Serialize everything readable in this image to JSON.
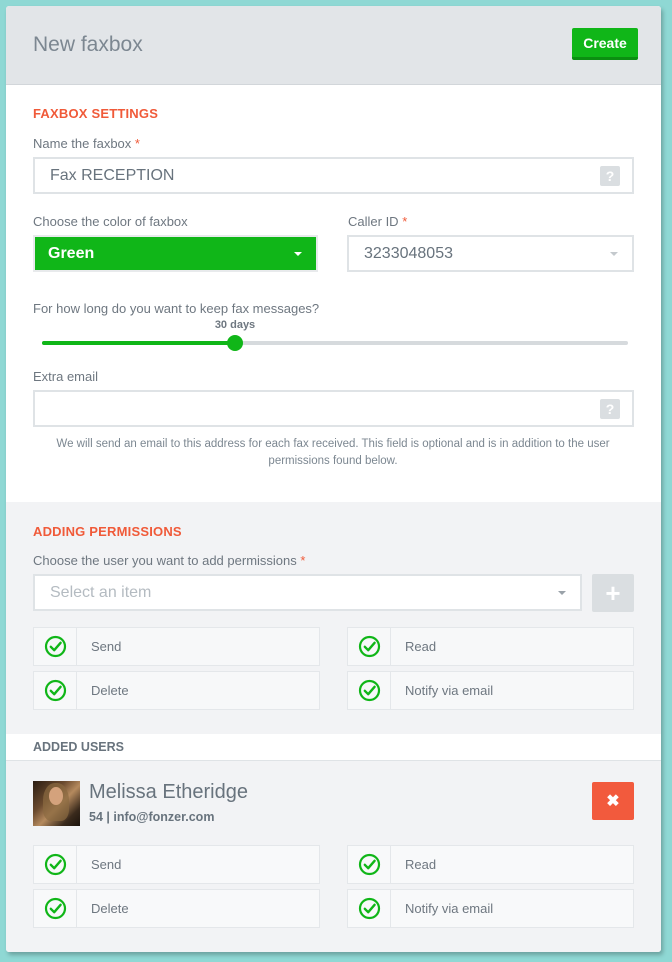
{
  "header": {
    "title": "New faxbox",
    "create_label": "Create"
  },
  "settings": {
    "section_title": "FAXBOX SETTINGS",
    "name_label": "Name the faxbox",
    "name_value": "Fax RECEPTION",
    "color_label": "Choose the color of faxbox",
    "color_value": "Green",
    "caller_id_label": "Caller ID",
    "caller_id_value": "3233048053",
    "retention_label": "For how long do you want to keep fax messages?",
    "retention_value": "30 days",
    "retention_fraction": 0.33,
    "extra_email_label": "Extra email",
    "extra_email_value": "",
    "extra_email_hint": "We will send an email to this address for each fax received. This field is optional and is in addition to the user permissions found below.",
    "required_mark": "*",
    "help_glyph": "?"
  },
  "permissions": {
    "section_title": "ADDING PERMISSIONS",
    "user_label": "Choose the user you want to add permissions",
    "user_placeholder": "Select an item",
    "add_glyph": "+",
    "items": [
      {
        "label": "Send"
      },
      {
        "label": "Read"
      },
      {
        "label": "Delete"
      },
      {
        "label": "Notify via email"
      }
    ]
  },
  "added_users": {
    "section_title": "ADDED USERS",
    "users": [
      {
        "name": "Melissa Etheridge",
        "meta": "54 | info@fonzer.com",
        "remove_glyph": "✖",
        "permissions": [
          {
            "label": "Send"
          },
          {
            "label": "Read"
          },
          {
            "label": "Delete"
          },
          {
            "label": "Notify via email"
          }
        ]
      }
    ]
  },
  "colors": {
    "accent_green": "#10b618",
    "accent_orange": "#f05a39",
    "remove_red": "#f25a3d"
  }
}
